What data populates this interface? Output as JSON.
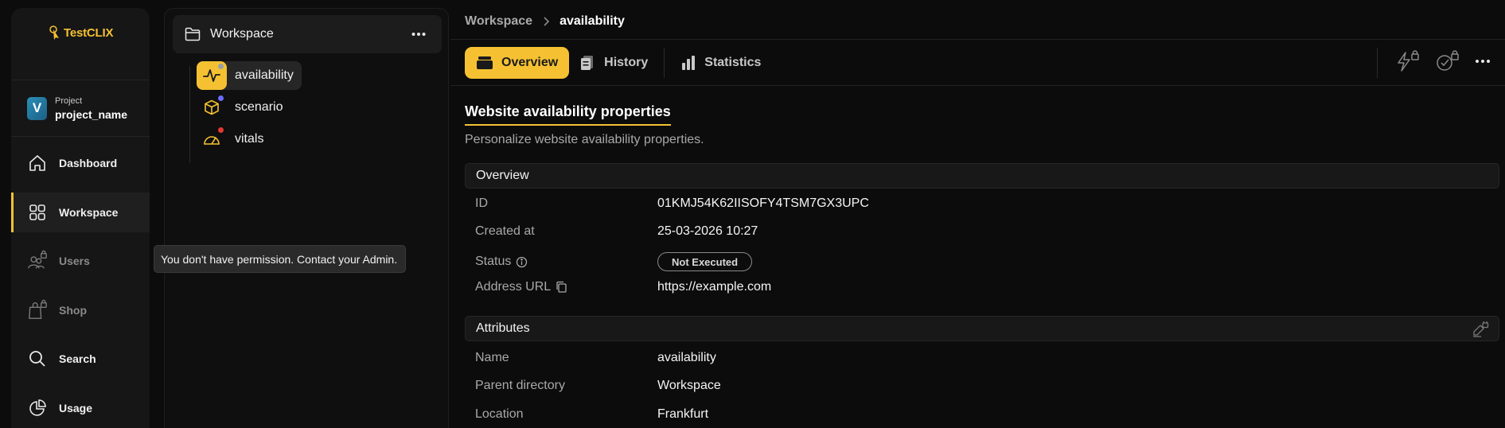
{
  "app": {
    "logo_text": "TestCLIX"
  },
  "project": {
    "avatar_letter": "V",
    "caption": "Project",
    "name": "project_name"
  },
  "nav": {
    "items": [
      {
        "label": "Dashboard",
        "icon": "home-icon"
      },
      {
        "label": "Workspace",
        "icon": "grid-icon",
        "active": true
      },
      {
        "label": "Users",
        "icon": "users-lock-icon",
        "disabled": true
      },
      {
        "label": "Shop",
        "icon": "shop-lock-icon",
        "disabled": true
      },
      {
        "label": "Search",
        "icon": "search-icon"
      },
      {
        "label": "Usage",
        "icon": "pie-chart-icon"
      }
    ]
  },
  "tooltip": {
    "text": "You don't have permission. Contact your Admin."
  },
  "tree": {
    "header": "Workspace",
    "items": [
      {
        "label": "availability",
        "icon": "pulse-icon",
        "dot_color": "#9aa0a6",
        "selected": true
      },
      {
        "label": "scenario",
        "icon": "cube-icon",
        "dot_color": "#6a6cff"
      },
      {
        "label": "vitals",
        "icon": "gauge-icon",
        "dot_color": "#e53935"
      }
    ]
  },
  "breadcrumb": {
    "parent": "Workspace",
    "current": "availability"
  },
  "tabs": [
    {
      "label": "Overview",
      "active": true
    },
    {
      "label": "History"
    },
    {
      "label": "Statistics"
    }
  ],
  "content": {
    "title": "Website availability properties",
    "subtitle": "Personalize website availability properties.",
    "overview": {
      "heading": "Overview",
      "rows": [
        {
          "key": "ID",
          "value": "01KMJ54K62IISOFY4TSM7GX3UPC"
        },
        {
          "key": "Created at",
          "value": "25-03-2026 10:27"
        },
        {
          "key": "Status",
          "value": "Not Executed"
        },
        {
          "key": "Address URL",
          "value": "https://example.com"
        }
      ]
    },
    "attributes": {
      "heading": "Attributes",
      "rows": [
        {
          "key": "Name",
          "value": "availability"
        },
        {
          "key": "Parent directory",
          "value": "Workspace"
        },
        {
          "key": "Location",
          "value": "Frankfurt"
        }
      ]
    }
  },
  "colors": {
    "accent": "#f5c132",
    "background": "#0c0c0c",
    "panel": "#161616"
  }
}
